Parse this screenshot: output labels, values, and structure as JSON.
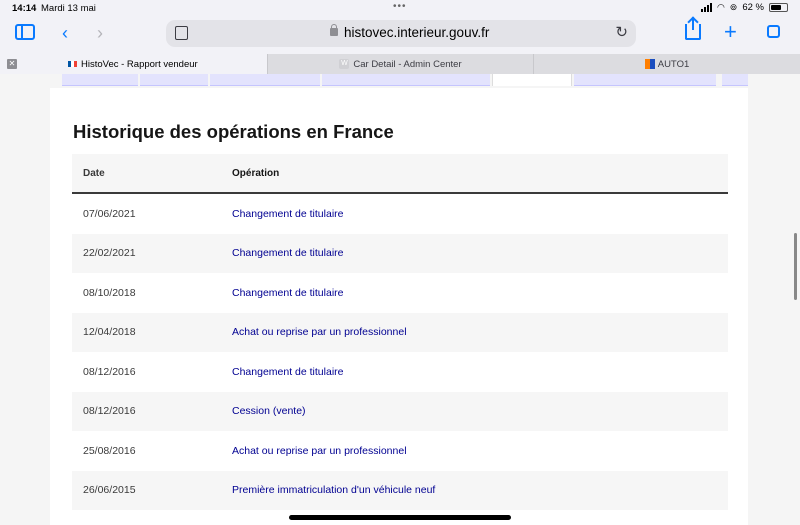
{
  "status": {
    "time": "14:14",
    "date": "Mardi 13 mai",
    "battery": "62 %",
    "battery_level": 0.62
  },
  "toolbar": {
    "url": "histovec.interieur.gouv.fr"
  },
  "tabs": [
    {
      "label": "HistoVec - Rapport vendeur",
      "active": true
    },
    {
      "label": "Car Detail - Admin Center",
      "active": false
    },
    {
      "label": "AUTO1",
      "active": false
    }
  ],
  "section": {
    "title": "Historique des opérations en France"
  },
  "table": {
    "headers": {
      "date": "Date",
      "operation": "Opération"
    },
    "rows": [
      {
        "date": "07/06/2021",
        "operation": "Changement de titulaire"
      },
      {
        "date": "22/02/2021",
        "operation": "Changement de titulaire"
      },
      {
        "date": "08/10/2018",
        "operation": "Changement de titulaire"
      },
      {
        "date": "12/04/2018",
        "operation": "Achat ou reprise par un professionnel"
      },
      {
        "date": "08/12/2016",
        "operation": "Changement de titulaire"
      },
      {
        "date": "08/12/2016",
        "operation": "Cession (vente)"
      },
      {
        "date": "25/08/2016",
        "operation": "Achat ou reprise par un professionnel"
      },
      {
        "date": "26/06/2015",
        "operation": "Première immatriculation d'un véhicule neuf"
      }
    ]
  }
}
